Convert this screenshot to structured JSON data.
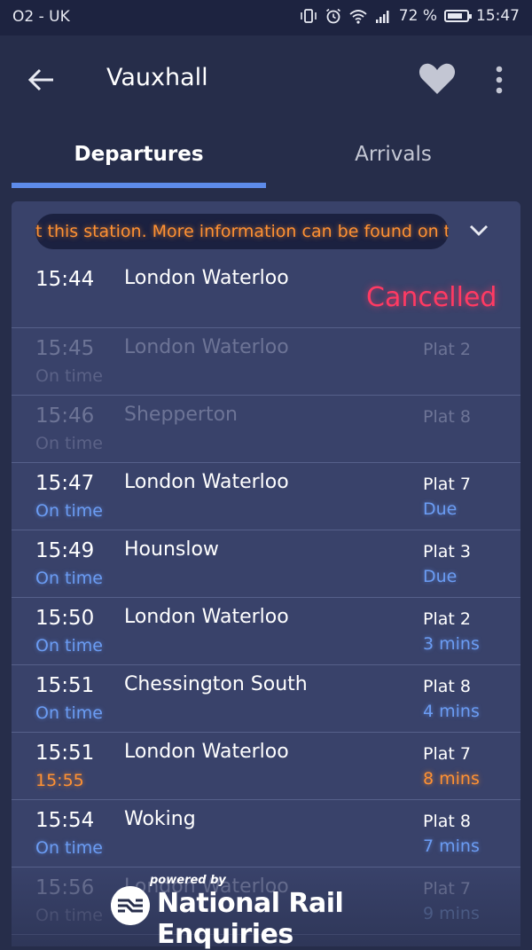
{
  "status_bar": {
    "carrier": "O2 - UK",
    "battery": "72 %",
    "time": "15:47"
  },
  "app_bar": {
    "title": "Vauxhall"
  },
  "tabs": [
    {
      "label": "Departures",
      "active": true
    },
    {
      "label": "Arrivals",
      "active": false
    }
  ],
  "alert": {
    "text": "t this station. More information can be found on the"
  },
  "departures": [
    {
      "time": "15:44",
      "destination": "London Waterloo",
      "status": "",
      "platform": "",
      "eta": "",
      "cancelled_label": "Cancelled"
    },
    {
      "time": "15:45",
      "destination": "London Waterloo",
      "status": "On time",
      "platform": "Plat 2",
      "eta": ""
    },
    {
      "time": "15:46",
      "destination": "Shepperton",
      "status": "On time",
      "platform": "Plat 8",
      "eta": ""
    },
    {
      "time": "15:47",
      "destination": "London Waterloo",
      "status": "On time",
      "platform": "Plat 7",
      "eta": "Due"
    },
    {
      "time": "15:49",
      "destination": "Hounslow",
      "status": "On time",
      "platform": "Plat 3",
      "eta": "Due"
    },
    {
      "time": "15:50",
      "destination": "London Waterloo",
      "status": "On time",
      "platform": "Plat 2",
      "eta": "3 mins"
    },
    {
      "time": "15:51",
      "destination": "Chessington South",
      "status": "On time",
      "platform": "Plat 8",
      "eta": "4 mins"
    },
    {
      "time": "15:51",
      "destination": "London Waterloo",
      "status": "15:55",
      "platform": "Plat 7",
      "eta": "8 mins"
    },
    {
      "time": "15:54",
      "destination": "Woking",
      "status": "On time",
      "platform": "Plat 8",
      "eta": "7 mins"
    },
    {
      "time": "15:56",
      "destination": "London Waterloo",
      "status": "On time",
      "platform": "Plat 7",
      "eta": "9 mins"
    }
  ],
  "footer": {
    "powered_by": "powered by",
    "brand": "National Rail Enquiries"
  },
  "colors": {
    "background": "#262d4a",
    "card": "#39426a",
    "accent_blue": "#6b9cf3",
    "tab_indicator": "#5d8bea",
    "delay_orange": "#ff9133",
    "cancelled_red": "#ff3a63"
  },
  "icons": {
    "back": "arrow-left-icon",
    "favourite": "heart-icon",
    "more": "more-vertical-icon",
    "expand": "chevron-down-icon",
    "brand": "national-rail-logo-icon"
  }
}
